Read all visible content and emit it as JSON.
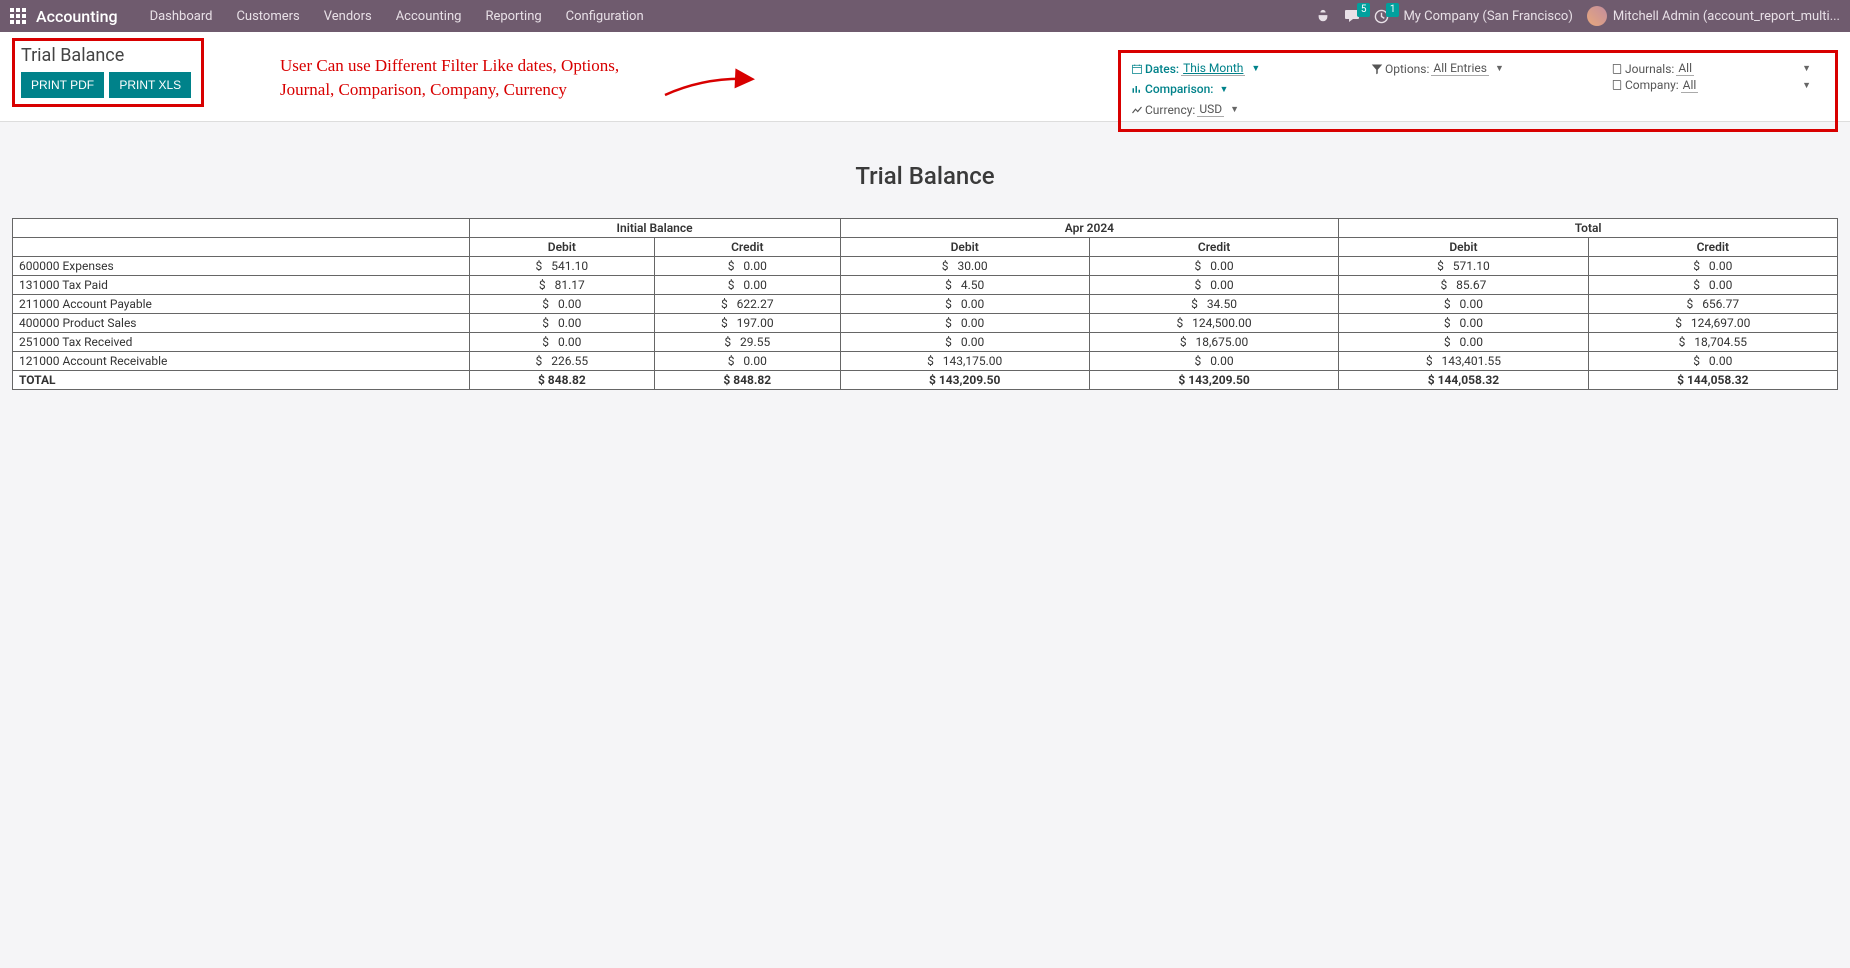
{
  "topbar": {
    "brand": "Accounting",
    "menu": [
      "Dashboard",
      "Customers",
      "Vendors",
      "Accounting",
      "Reporting",
      "Configuration"
    ],
    "chat_badge": "5",
    "activity_badge": "1",
    "company": "My Company (San Francisco)",
    "user": "Mitchell Admin (account_report_multi..."
  },
  "control": {
    "title": "Trial Balance",
    "print_pdf": "PRINT PDF",
    "print_xls": "PRINT XLS"
  },
  "annotation": {
    "line1": "User Can use Different Filter Like dates, Options,",
    "line2": "Journal, Comparison, Company, Currency"
  },
  "filters": {
    "dates_label": "Dates:",
    "dates_value": "This Month",
    "options_label": "Options:",
    "options_value": "All Entries",
    "journals_label": "Journals:",
    "journals_value": "All",
    "comparison_label": "Comparison:",
    "company_label": "Company:",
    "company_value": "All",
    "currency_label": "Currency:",
    "currency_value": "USD"
  },
  "report": {
    "title": "Trial Balance",
    "currency_symbol": "$",
    "group_headers": [
      "",
      "Initial Balance",
      "Apr 2024",
      "Total"
    ],
    "sub_headers": [
      "",
      "Debit",
      "Credit",
      "Debit",
      "Credit",
      "Debit",
      "Credit"
    ],
    "rows": [
      {
        "account": "600000 Expenses",
        "v": [
          "541.10",
          "0.00",
          "30.00",
          "0.00",
          "571.10",
          "0.00"
        ]
      },
      {
        "account": "131000 Tax Paid",
        "v": [
          "81.17",
          "0.00",
          "4.50",
          "0.00",
          "85.67",
          "0.00"
        ]
      },
      {
        "account": "211000 Account Payable",
        "v": [
          "0.00",
          "622.27",
          "0.00",
          "34.50",
          "0.00",
          "656.77"
        ]
      },
      {
        "account": "400000 Product Sales",
        "v": [
          "0.00",
          "197.00",
          "0.00",
          "124,500.00",
          "0.00",
          "124,697.00"
        ]
      },
      {
        "account": "251000 Tax Received",
        "v": [
          "0.00",
          "29.55",
          "0.00",
          "18,675.00",
          "0.00",
          "18,704.55"
        ]
      },
      {
        "account": "121000 Account Receivable",
        "v": [
          "226.55",
          "0.00",
          "143,175.00",
          "0.00",
          "143,401.55",
          "0.00"
        ]
      }
    ],
    "total": {
      "label": "TOTAL",
      "v": [
        "848.82",
        "848.82",
        "143,209.50",
        "143,209.50",
        "144,058.32",
        "144,058.32"
      ]
    }
  }
}
